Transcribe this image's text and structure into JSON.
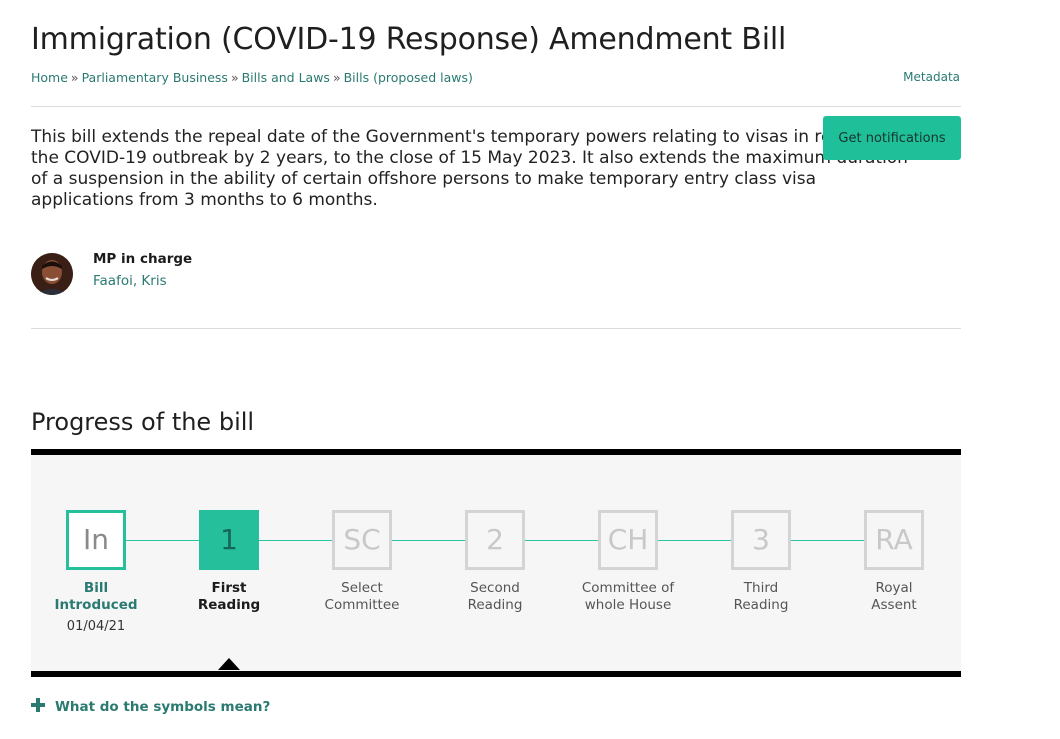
{
  "page": {
    "title": "Immigration (COVID-19 Response) Amendment Bill",
    "metadata_link": "Metadata"
  },
  "breadcrumb": [
    {
      "label": "Home"
    },
    {
      "label": "Parliamentary Business"
    },
    {
      "label": "Bills and Laws"
    },
    {
      "label": "Bills (proposed laws)"
    }
  ],
  "breadcrumb_separator": "»",
  "summary": {
    "text": "This bill extends the repeal date of the Government's temporary powers relating to visas in response to the COVID-19 outbreak by 2 years, to the close of 15 May 2023. It also extends the maximum duration of a suspension in the ability of certain offshore persons to make temporary entry class visa applications from 3 months to 6 months."
  },
  "notify_button": {
    "label": "Get notifications"
  },
  "mp": {
    "label": "MP in charge",
    "name": "Faafoi, Kris"
  },
  "progress": {
    "heading": "Progress of the bill",
    "stages": [
      {
        "code": "In",
        "label_line1": "Bill",
        "label_line2": "Introduced",
        "date": "01/04/21",
        "state": "done"
      },
      {
        "code": "1",
        "label_line1": "First",
        "label_line2": "Reading",
        "date": "",
        "state": "current"
      },
      {
        "code": "SC",
        "label_line1": "Select",
        "label_line2": "Committee",
        "date": "",
        "state": "pending"
      },
      {
        "code": "2",
        "label_line1": "Second",
        "label_line2": "Reading",
        "date": "",
        "state": "pending"
      },
      {
        "code": "CH",
        "label_line1": "Committee of",
        "label_line2": "whole House",
        "date": "",
        "state": "pending"
      },
      {
        "code": "3",
        "label_line1": "Third",
        "label_line2": "Reading",
        "date": "",
        "state": "pending"
      },
      {
        "code": "RA",
        "label_line1": "Royal",
        "label_line2": "Assent",
        "date": "",
        "state": "pending"
      }
    ]
  },
  "symbols_link": {
    "label": "What do the symbols mean?",
    "icon": "plus-icon"
  },
  "colors": {
    "accent": "#25bf9c",
    "link": "#2a7a72",
    "button": "#1fbf99"
  }
}
